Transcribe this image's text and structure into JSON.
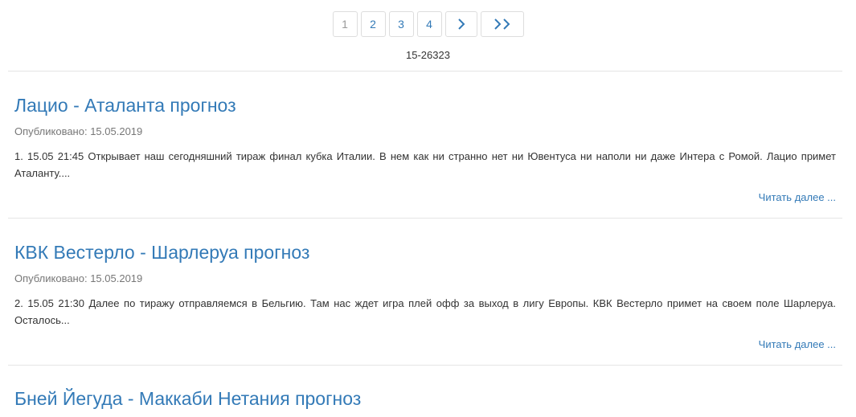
{
  "pagination": {
    "pages": [
      "1",
      "2",
      "3",
      "4"
    ],
    "active_page": "1",
    "next_icon": "chevron-right-icon",
    "last_icon": "double-chevron-right-icon"
  },
  "counter": "15-26323",
  "articles": [
    {
      "title": "Лацио - Аталанта прогноз",
      "published": "Опубликовано: 15.05.2019",
      "excerpt": "1. 15.05 21:45 Открывает наш сегодняшний тираж финал кубка Италии. В нем как ни странно нет ни Ювентуса ни наполи ни даже Интера с Ромой. Лацио примет Аталанту....",
      "read_more": "Читать далее ..."
    },
    {
      "title": "КВК Вестерло - Шарлеруа прогноз",
      "published": "Опубликовано: 15.05.2019",
      "excerpt": "2. 15.05 21:30 Далее по тиражу отправляемся в Бельгию. Там нас ждет игра плей офф за выход в лигу Европы. КВК Вестерло примет на своем поле Шарлеруа. Осталось...",
      "read_more": "Читать далее ..."
    },
    {
      "title": "Бней Йегуда - Маккаби Нетания прогноз"
    }
  ],
  "colors": {
    "link": "#337ab7",
    "muted": "#777777",
    "divider": "#e5e5e5"
  }
}
